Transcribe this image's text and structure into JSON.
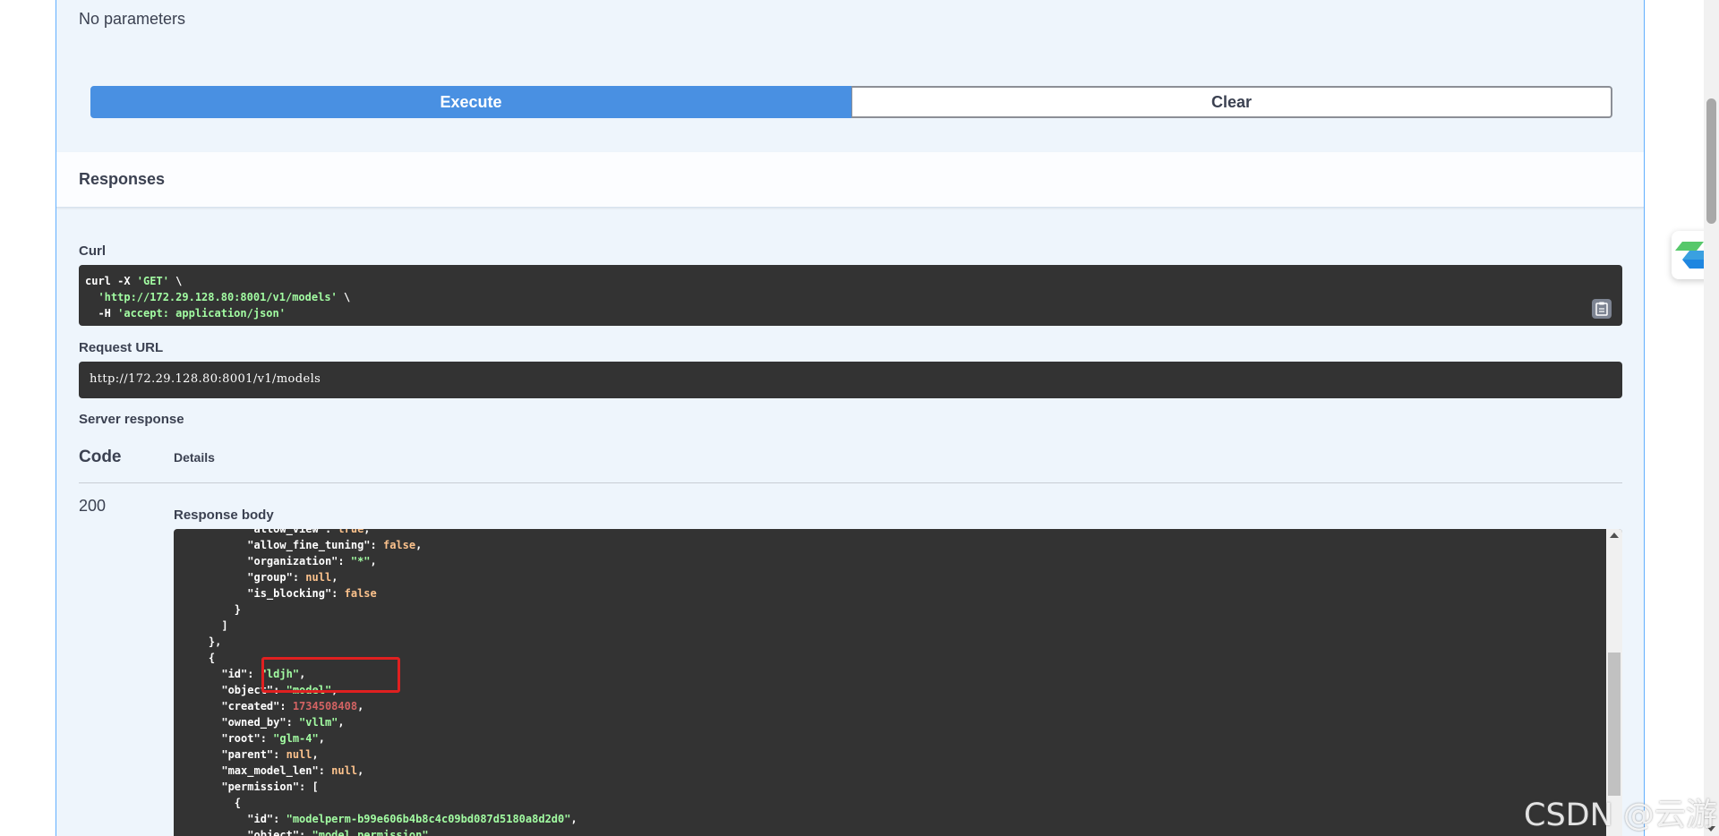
{
  "parameters": {
    "empty_text": "No parameters"
  },
  "actions": {
    "execute_label": "Execute",
    "clear_label": "Clear"
  },
  "responses": {
    "title": "Responses"
  },
  "curl": {
    "label": "Curl",
    "line1_a": "curl -X ",
    "line1_method": "'GET'",
    "line1_b": " \\",
    "line2_url": "'http://172.29.128.80:8001/v1/models'",
    "line2_b": " \\",
    "line3_a": "  -H ",
    "line3_header": "'accept: application/json'"
  },
  "request_url": {
    "label": "Request URL",
    "value": "http://172.29.128.80:8001/v1/models"
  },
  "server_response": {
    "label": "Server response",
    "col_code": "Code",
    "col_details": "Details",
    "status_code": "200",
    "body_label": "Response body"
  },
  "watermark": "CSDN @云游",
  "colors": {
    "execute_blue": "#4990e2",
    "code_bg": "#333333",
    "string_green": "#a2fca2",
    "number_red": "#d36363",
    "bool_orange": "#fcc28c",
    "highlight_red": "#e02020"
  },
  "response_lines": [
    {
      "t": [
        [
          "k",
          "          \"allow_view\": "
        ],
        [
          "b",
          "true"
        ],
        [
          "k",
          ","
        ]
      ]
    },
    {
      "t": [
        [
          "k",
          "          \"allow_fine_tuning\": "
        ],
        [
          "b",
          "false"
        ],
        [
          "k",
          ","
        ]
      ]
    },
    {
      "t": [
        [
          "k",
          "          \"organization\": "
        ],
        [
          "s",
          "\"*\""
        ],
        [
          "k",
          ","
        ]
      ]
    },
    {
      "t": [
        [
          "k",
          "          \"group\": "
        ],
        [
          "b",
          "null"
        ],
        [
          "k",
          ","
        ]
      ]
    },
    {
      "t": [
        [
          "k",
          "          \"is_blocking\": "
        ],
        [
          "b",
          "false"
        ]
      ]
    },
    {
      "t": [
        [
          "k",
          "        }"
        ]
      ]
    },
    {
      "t": [
        [
          "k",
          "      ]"
        ]
      ]
    },
    {
      "t": [
        [
          "k",
          "    },"
        ]
      ]
    },
    {
      "t": [
        [
          "k",
          "    {"
        ]
      ]
    },
    {
      "t": [
        [
          "k",
          "      \"id\": "
        ],
        [
          "s",
          "\"ldjh\""
        ],
        [
          "k",
          ","
        ]
      ]
    },
    {
      "t": [
        [
          "k",
          "      \"object\": "
        ],
        [
          "s",
          "\"model\""
        ],
        [
          "k",
          ","
        ]
      ]
    },
    {
      "t": [
        [
          "k",
          "      \"created\": "
        ],
        [
          "n",
          "1734508408"
        ],
        [
          "k",
          ","
        ]
      ]
    },
    {
      "t": [
        [
          "k",
          "      \"owned_by\": "
        ],
        [
          "s",
          "\"vllm\""
        ],
        [
          "k",
          ","
        ]
      ]
    },
    {
      "t": [
        [
          "k",
          "      \"root\": "
        ],
        [
          "s",
          "\"glm-4\""
        ],
        [
          "k",
          ","
        ]
      ]
    },
    {
      "t": [
        [
          "k",
          "      \"parent\": "
        ],
        [
          "b",
          "null"
        ],
        [
          "k",
          ","
        ]
      ]
    },
    {
      "t": [
        [
          "k",
          "      \"max_model_len\": "
        ],
        [
          "b",
          "null"
        ],
        [
          "k",
          ","
        ]
      ]
    },
    {
      "t": [
        [
          "k",
          "      \"permission\": ["
        ]
      ]
    },
    {
      "t": [
        [
          "k",
          "        {"
        ]
      ]
    },
    {
      "t": [
        [
          "k",
          "          \"id\": "
        ],
        [
          "s",
          "\"modelperm-b99e606b4b8c4c09bd087d5180a8d2d0\""
        ],
        [
          "k",
          ","
        ]
      ]
    },
    {
      "t": [
        [
          "k",
          "          \"object\": "
        ],
        [
          "s",
          "\"model_permission\""
        ],
        [
          "k",
          ","
        ]
      ]
    }
  ]
}
